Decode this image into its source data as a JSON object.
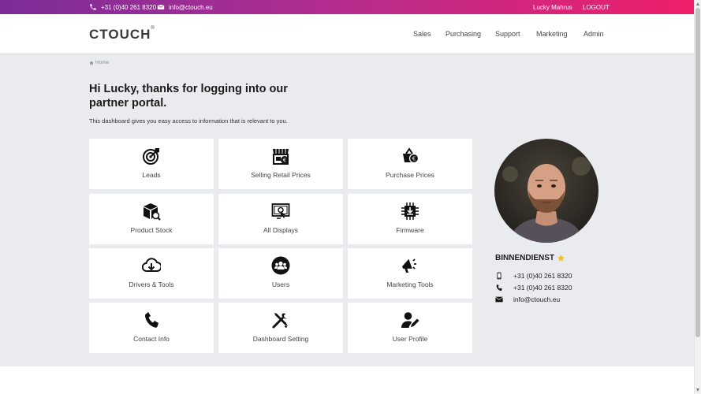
{
  "topbar": {
    "phone": "+31 (0)40 261 8320",
    "email": "info@ctouch.eu",
    "user_name": "Lucky Mahrus",
    "logout_label": "LOGOUT",
    "colors": {
      "gradient_start": "#7b2d9a",
      "gradient_end": "#ef1f6a"
    }
  },
  "header": {
    "logo_text": "CTOUCH",
    "logo_mark": "®",
    "nav": [
      "Sales",
      "Purchasing",
      "Support",
      "Marketing",
      "Admin"
    ]
  },
  "breadcrumb": {
    "home_label": "Home",
    "icon": "home-icon"
  },
  "welcome": {
    "title": "Hi Lucky, thanks for logging into our partner portal.",
    "subtitle": "This dashboard gives you easy access to information that is relevant to you."
  },
  "tiles": [
    {
      "label": "Leads",
      "icon": "target-icon"
    },
    {
      "label": "Selling Retail Prices",
      "icon": "shop-price-icon"
    },
    {
      "label": "Purchase Prices",
      "icon": "basket-euro-icon"
    },
    {
      "label": "Product Stock",
      "icon": "box-search-icon"
    },
    {
      "label": "All Displays",
      "icon": "display-icon"
    },
    {
      "label": "Firmware",
      "icon": "chip-download-icon"
    },
    {
      "label": "Drivers & Tools",
      "icon": "cloud-download-icon"
    },
    {
      "label": "Users",
      "icon": "users-icon"
    },
    {
      "label": "Marketing Tools",
      "icon": "megaphone-icon"
    },
    {
      "label": "Contact Info",
      "icon": "phone-icon"
    },
    {
      "label": "Dashboard Setting",
      "icon": "tools-icon"
    },
    {
      "label": "User Profile",
      "icon": "user-edit-icon"
    }
  ],
  "contact": {
    "title": "BINNENDIENST",
    "star_color": "#f4c21b",
    "mobile": "+31 (0)40 261 8320",
    "phone": "+31 (0)40 261 8320",
    "email": "info@ctouch.eu"
  }
}
